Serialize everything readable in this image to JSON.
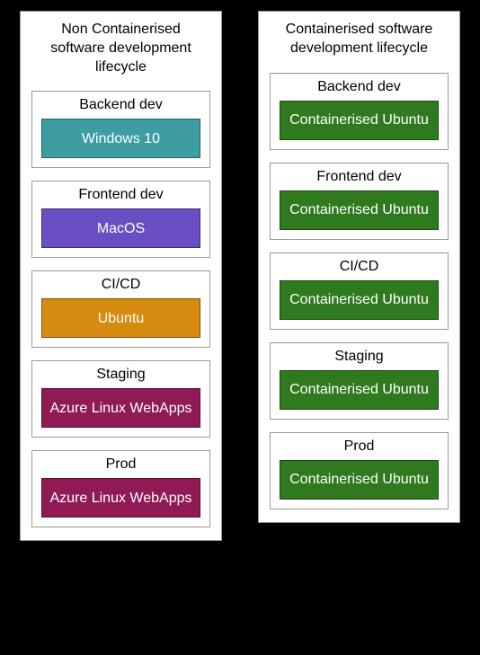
{
  "left": {
    "title": "Non Containerised software development lifecycle",
    "stages": [
      {
        "title": "Backend dev",
        "env": "Windows 10",
        "color": "c-teal"
      },
      {
        "title": "Frontend dev",
        "env": "MacOS",
        "color": "c-purple"
      },
      {
        "title": "CI/CD",
        "env": "Ubuntu",
        "color": "c-orange"
      },
      {
        "title": "Staging",
        "env": "Azure Linux WebApps",
        "color": "c-maroon"
      },
      {
        "title": "Prod",
        "env": "Azure Linux WebApps",
        "color": "c-maroon"
      }
    ]
  },
  "right": {
    "title": "Containerised software development lifecycle",
    "stages": [
      {
        "title": "Backend dev",
        "env": "Containerised Ubuntu",
        "color": "c-green"
      },
      {
        "title": "Frontend dev",
        "env": "Containerised Ubuntu",
        "color": "c-green"
      },
      {
        "title": "CI/CD",
        "env": "Containerised Ubuntu",
        "color": "c-green"
      },
      {
        "title": "Staging",
        "env": "Containerised Ubuntu",
        "color": "c-green"
      },
      {
        "title": "Prod",
        "env": "Containerised Ubuntu",
        "color": "c-green"
      }
    ]
  }
}
